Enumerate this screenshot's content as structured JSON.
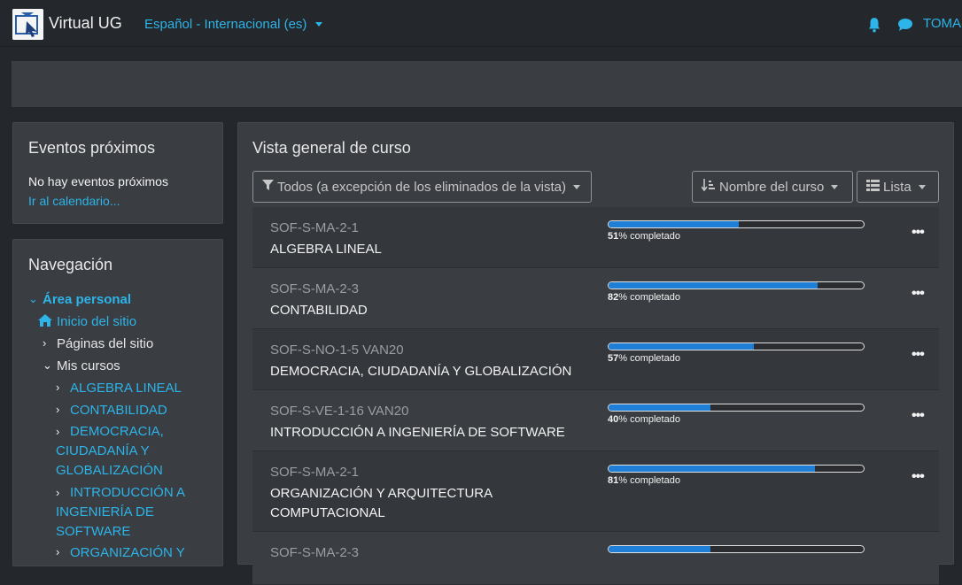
{
  "navbar": {
    "brand": "Virtual UG",
    "language": "Español - Internacional (es)",
    "user": "TOMAS"
  },
  "events": {
    "title": "Eventos próximos",
    "empty": "No hay eventos próximos",
    "calendar_link": "Ir al calendario..."
  },
  "navigation": {
    "title": "Navegación",
    "personal": "Área personal",
    "home": "Inicio del sitio",
    "site_pages": "Páginas del sitio",
    "my_courses": "Mis cursos",
    "courses": [
      "ALGEBRA LINEAL",
      "CONTABILIDAD",
      "DEMOCRACIA, CIUDADANÍA Y GLOBALIZACIÓN",
      "INTRODUCCIÓN A INGENIERÍA DE SOFTWARE",
      "ORGANIZACIÓN Y"
    ],
    "wrapped": {
      "democracia": [
        "DEMOCRACIA,",
        "CIUDADANÍA Y",
        "GLOBALIZACIÓN"
      ],
      "intro": [
        "INTRODUCCIÓN A",
        "INGENIERÍA DE",
        "SOFTWARE"
      ]
    }
  },
  "overview": {
    "title": "Vista general de curso",
    "filter": "Todos (a excepción de los eliminados de la vista)",
    "sort": "Nombre del curso",
    "view": "Lista",
    "progress_suffix": "% completado",
    "courses": [
      {
        "code": "SOF-S-MA-2-1",
        "name": "ALGEBRA LINEAL",
        "progress": 51
      },
      {
        "code": "SOF-S-MA-2-3",
        "name": "CONTABILIDAD",
        "progress": 82
      },
      {
        "code": "SOF-S-NO-1-5 VAN20",
        "name": "DEMOCRACIA, CIUDADANÍA Y GLOBALIZACIÓN",
        "progress": 57
      },
      {
        "code": "SOF-S-VE-1-16 VAN20",
        "name": "INTRODUCCIÓN A INGENIERÍA DE SOFTWARE",
        "progress": 40
      },
      {
        "code": "SOF-S-MA-2-1",
        "name": "ORGANIZACIÓN Y ARQUITECTURA COMPUTACIONAL",
        "progress": 81
      },
      {
        "code": "SOF-S-MA-2-3",
        "name": "",
        "progress": 40
      }
    ]
  },
  "colors": {
    "accent": "#2db4e8",
    "progress": "#1f7ed6",
    "panel": "#3a3d42",
    "background": "#24272b"
  }
}
